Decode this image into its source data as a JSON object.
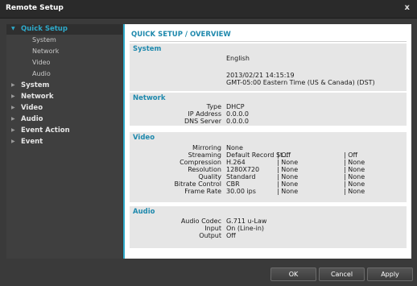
{
  "window": {
    "title": "Remote Setup",
    "close_glyph": "x"
  },
  "sidebar": {
    "items": [
      {
        "label": "Quick Setup",
        "expanded": true,
        "selected": true,
        "children": [
          "System",
          "Network",
          "Video",
          "Audio"
        ]
      },
      {
        "label": "System"
      },
      {
        "label": "Network"
      },
      {
        "label": "Video"
      },
      {
        "label": "Audio"
      },
      {
        "label": "Event Action"
      },
      {
        "label": "Event"
      }
    ]
  },
  "content": {
    "title": "QUICK SETUP / OVERVIEW",
    "system": {
      "heading": "System",
      "language": "English",
      "datetime": "2013/02/21 14:15:19",
      "timezone": "GMT-05:00 Eastern Time (US & Canada) (DST)"
    },
    "network": {
      "heading": "Network",
      "rows": [
        {
          "label": "Type",
          "value": "DHCP"
        },
        {
          "label": "IP Address",
          "value": "0.0.0.0"
        },
        {
          "label": "DNS Server",
          "value": "0.0.0.0"
        }
      ]
    },
    "video": {
      "heading": "Video",
      "mirroring": {
        "label": "Mirroring",
        "value": "None"
      },
      "rows": [
        {
          "label": "Streaming",
          "c1": "Default Record St...",
          "c2": "| Off",
          "c3": "| Off"
        },
        {
          "label": "Compression",
          "c1": "H.264",
          "c2": "| None",
          "c3": "| None"
        },
        {
          "label": "Resolution",
          "c1": "1280X720",
          "c2": "| None",
          "c3": "| None"
        },
        {
          "label": "Quality",
          "c1": "Standard",
          "c2": "| None",
          "c3": "| None"
        },
        {
          "label": "Bitrate Control",
          "c1": "CBR",
          "c2": "| None",
          "c3": "| None"
        },
        {
          "label": "Frame Rate",
          "c1": "30.00 ips",
          "c2": "| None",
          "c3": "| None"
        }
      ]
    },
    "audio": {
      "heading": "Audio",
      "rows": [
        {
          "label": "Audio Codec",
          "value": "G.711 u-Law"
        },
        {
          "label": "Input",
          "value": "On (Line-in)"
        },
        {
          "label": "Output",
          "value": "Off"
        }
      ]
    }
  },
  "footer": {
    "ok": "OK",
    "cancel": "Cancel",
    "apply": "Apply"
  },
  "colors": {
    "accent": "#2ea9c9",
    "heading": "#1f89ad",
    "section_bg": "#e6e6e6"
  }
}
